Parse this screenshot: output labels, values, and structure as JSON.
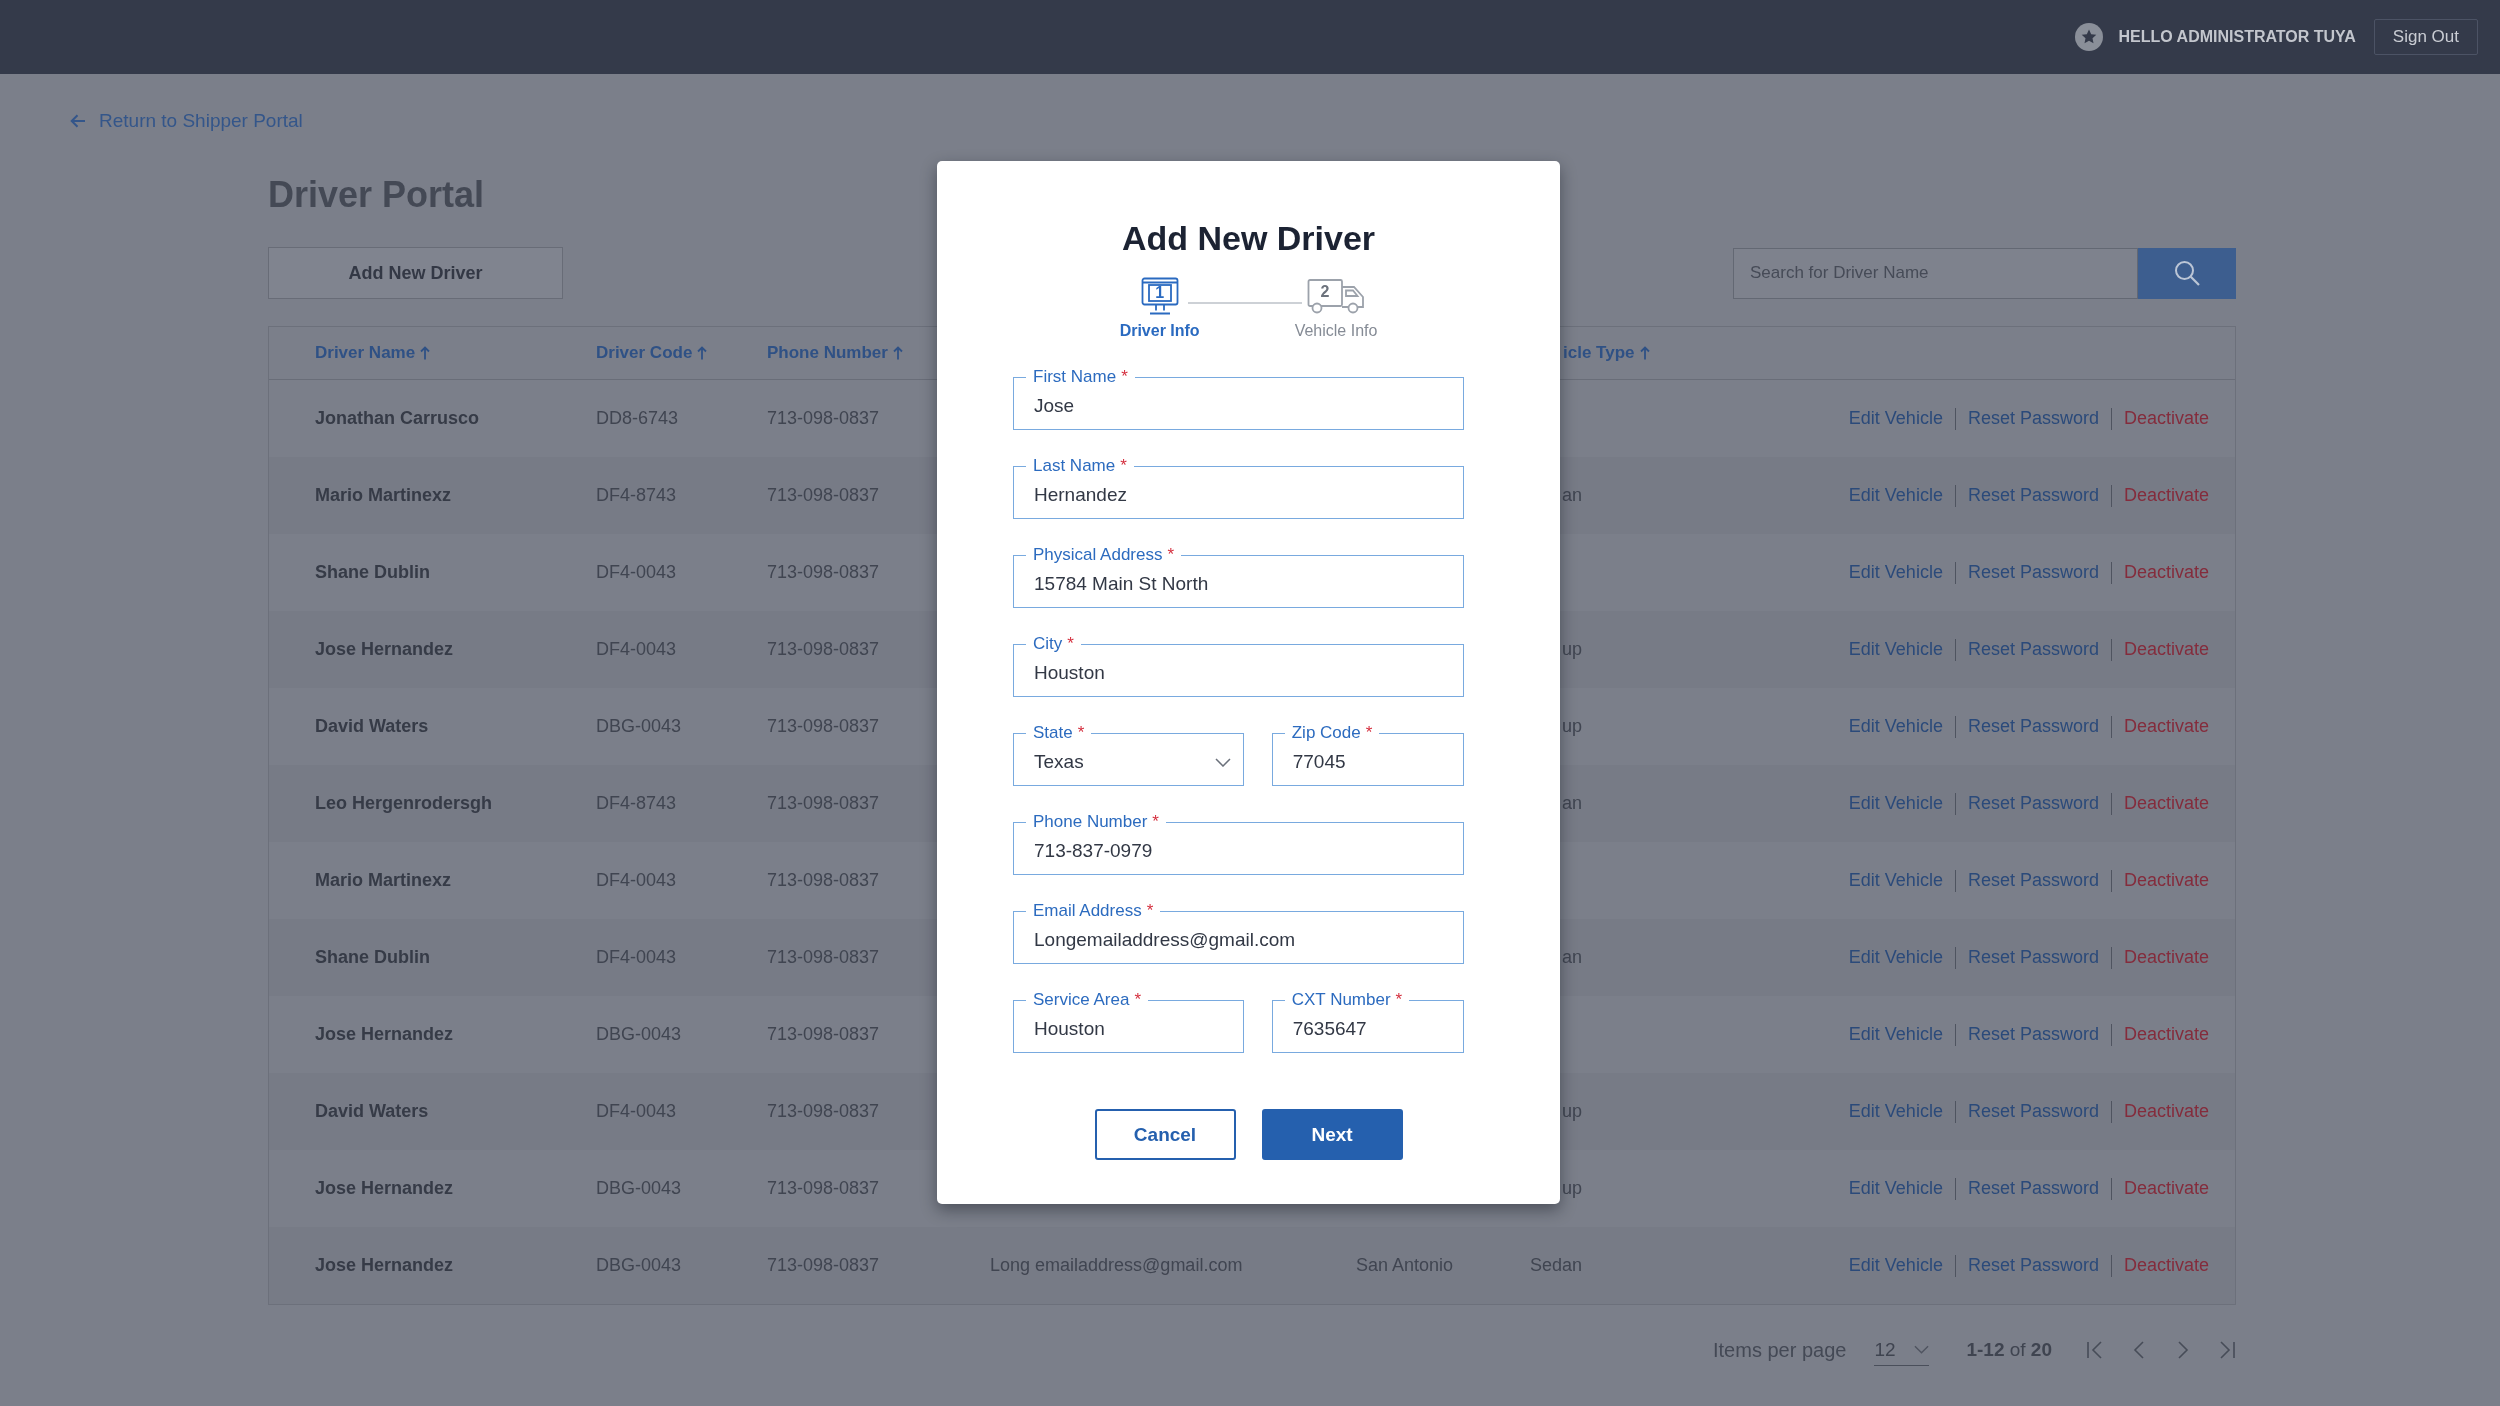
{
  "top_bar": {
    "greeting": "HELLO ADMINISTRATOR TUYA",
    "sign_out": "Sign Out"
  },
  "back_link": "Return to Shipper Portal",
  "page_title": "Driver Portal",
  "add_button": "Add New Driver",
  "search": {
    "placeholder": "Search for Driver Name"
  },
  "table": {
    "columns": [
      {
        "label": "Driver Name",
        "sorted": true
      },
      {
        "label": "Driver Code",
        "sorted": true
      },
      {
        "label": "Phone Number",
        "sorted": true
      },
      {
        "label": "icle Type",
        "sorted": true
      }
    ],
    "rows": [
      {
        "name": "Jonathan Carrusco",
        "code": "DD8-6743",
        "phone": "713-098-0837",
        "actions": [
          {
            "label": "Edit Vehicle",
            "kind": "link"
          },
          {
            "label": "Reset Password",
            "kind": "link"
          },
          {
            "label": "Deactivate",
            "kind": "danger"
          }
        ]
      },
      {
        "name": "Mario Martinexz",
        "code": "DF4-8743",
        "phone": "713-098-0837",
        "vehicle_type": "an",
        "actions": [
          {
            "label": "Edit Vehicle",
            "kind": "link"
          },
          {
            "label": "Reset Password",
            "kind": "link"
          },
          {
            "label": "Deactivate",
            "kind": "danger"
          }
        ]
      },
      {
        "name": "Shane Dublin",
        "code": "DF4-0043",
        "phone": "713-098-0837",
        "actions": [
          {
            "label": "Edit Vehicle",
            "kind": "link"
          },
          {
            "label": "Reset Password",
            "kind": "link"
          },
          {
            "label": "Deactivate",
            "kind": "danger"
          }
        ]
      },
      {
        "name": "Jose Hernandez",
        "code": "DF4-0043",
        "phone": "713-098-0837",
        "vehicle_type": "up",
        "actions": [
          {
            "label": "Edit Vehicle",
            "kind": "link"
          },
          {
            "label": "Reset Password",
            "kind": "link"
          },
          {
            "label": "Deactivate",
            "kind": "danger"
          }
        ]
      },
      {
        "name": "David Waters",
        "code": "DBG-0043",
        "phone": "713-098-0837",
        "vehicle_type": "up",
        "actions": [
          {
            "label": "Edit Vehicle",
            "kind": "link"
          },
          {
            "label": "Reset Password",
            "kind": "link"
          },
          {
            "label": "Deactivate",
            "kind": "danger"
          }
        ]
      },
      {
        "name": "Leo Hergenrodersgh",
        "code": "DF4-8743",
        "phone": "713-098-0837",
        "vehicle_type": "an",
        "actions": [
          {
            "label": "Edit Vehicle",
            "kind": "link"
          },
          {
            "label": "Reset Password",
            "kind": "link"
          },
          {
            "label": "Deactivate",
            "kind": "danger"
          }
        ]
      },
      {
        "name": "Mario Martinexz",
        "code": "DF4-0043",
        "phone": "713-098-0837",
        "actions": [
          {
            "label": "Edit Vehicle",
            "kind": "link"
          },
          {
            "label": "Reset Password",
            "kind": "link"
          },
          {
            "label": "Deactivate",
            "kind": "danger"
          }
        ]
      },
      {
        "name": "Shane Dublin",
        "code": "DF4-0043",
        "phone": "713-098-0837",
        "vehicle_type": "an",
        "actions": [
          {
            "label": "Edit Vehicle",
            "kind": "link"
          },
          {
            "label": "Reset Password",
            "kind": "link"
          },
          {
            "label": "Deactivate",
            "kind": "danger"
          }
        ]
      },
      {
        "name": "Jose Hernandez",
        "code": "DBG-0043",
        "phone": "713-098-0837",
        "actions": [
          {
            "label": "Edit Vehicle",
            "kind": "link"
          },
          {
            "label": "Reset Password",
            "kind": "link"
          },
          {
            "label": "Deactivate",
            "kind": "danger"
          }
        ]
      },
      {
        "name": "David Waters",
        "code": "DF4-0043",
        "phone": "713-098-0837",
        "vehicle_type": "up",
        "actions": [
          {
            "label": "Edit Vehicle",
            "kind": "link"
          },
          {
            "label": "Reset Password",
            "kind": "link"
          },
          {
            "label": "Deactivate",
            "kind": "danger"
          }
        ]
      },
      {
        "name": "Jose Hernandez",
        "code": "DBG-0043",
        "phone": "713-098-0837",
        "vehicle_type": "up",
        "actions": [
          {
            "label": "Edit Vehicle",
            "kind": "link"
          },
          {
            "label": "Reset Password",
            "kind": "link"
          },
          {
            "label": "Deactivate",
            "kind": "danger"
          }
        ]
      },
      {
        "name": "Jose Hernandez",
        "code": "DBG-0043",
        "phone": "713-098-0837",
        "email": "Long emailaddress@gmail.com",
        "city": "San Antonio",
        "vehicle_type": "Sedan",
        "actions": [
          {
            "label": "Edit Vehicle",
            "kind": "link"
          },
          {
            "label": "Reset Password",
            "kind": "link"
          },
          {
            "label": "Deactivate",
            "kind": "danger"
          }
        ]
      }
    ]
  },
  "pagination": {
    "label": "Items per page",
    "per_page": "12",
    "range": "**1-12** of **20**"
  },
  "modal": {
    "title": "Add New Driver",
    "steps": [
      {
        "number": "1",
        "label": "Driver Info",
        "selected": true,
        "kind": "driver"
      },
      {
        "number": "2",
        "label": "Vehicle Info",
        "selected": false,
        "kind": "vehicle"
      }
    ],
    "field_rows": [
      {
        "fields": [
          {
            "label": "First Name",
            "required_marker": "*",
            "value": "Jose",
            "kind": "text"
          }
        ]
      },
      {
        "fields": [
          {
            "label": "Last Name",
            "required_marker": "*",
            "value": "Hernandez",
            "kind": "text"
          }
        ]
      },
      {
        "fields": [
          {
            "label": "Physical Address",
            "required_marker": "*",
            "value": "15784 Main St North",
            "kind": "text"
          }
        ]
      },
      {
        "fields": [
          {
            "label": "City",
            "required_marker": "*",
            "value": "Houston",
            "kind": "text"
          }
        ]
      },
      {
        "fields": [
          {
            "label": "State",
            "required_marker": "*",
            "value": "Texas",
            "kind": "select"
          },
          {
            "label": "Zip Code",
            "required_marker": "*",
            "value": "77045",
            "kind": "text"
          }
        ]
      },
      {
        "fields": [
          {
            "label": "Phone Number",
            "required_marker": "*",
            "value": "713-837-0979",
            "kind": "text"
          }
        ]
      },
      {
        "fields": [
          {
            "label": "Email Address",
            "required_marker": "*",
            "value": "Longemailaddress@gmail.com",
            "kind": "text"
          }
        ]
      },
      {
        "fields": [
          {
            "label": "Service Area",
            "required_marker": "*",
            "value": "Houston",
            "kind": "text"
          },
          {
            "label": "CXT Number",
            "required_marker": "*",
            "value": "7635647",
            "kind": "text"
          }
        ]
      }
    ],
    "buttons": [
      {
        "label": "Cancel",
        "kind": "secondary"
      },
      {
        "label": "Next",
        "kind": "primary"
      }
    ]
  }
}
